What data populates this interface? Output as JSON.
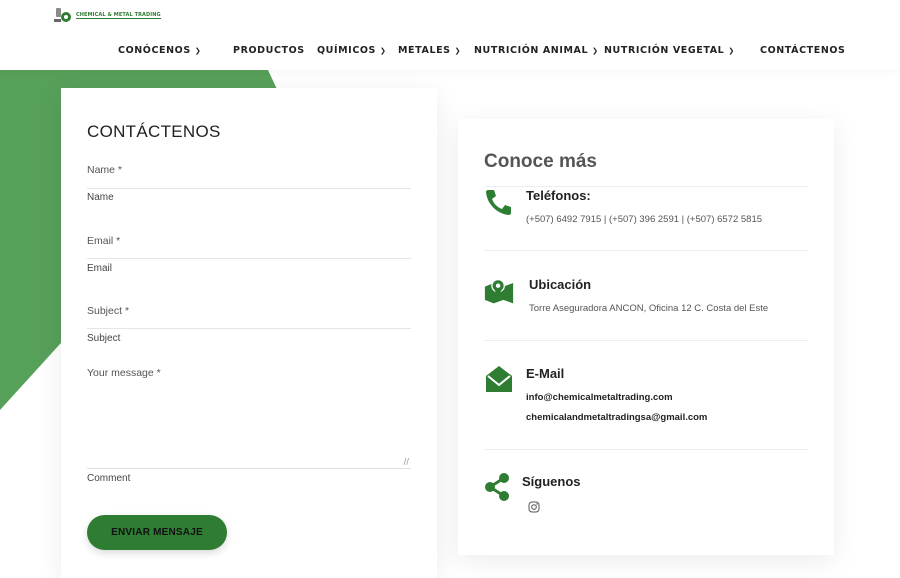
{
  "brand": {
    "logo_text": "CHEMICAL & METAL TRADING"
  },
  "nav": [
    {
      "label": "CONÓCENOS",
      "dropdown": true
    },
    {
      "label": "PRODUCTOS",
      "dropdown": false
    },
    {
      "label": "QUÍMICOS",
      "dropdown": true
    },
    {
      "label": "METALES",
      "dropdown": true
    },
    {
      "label": "NUTRICIÓN ANIMAL",
      "dropdown": true
    },
    {
      "label": "NUTRICIÓN VEGETAL",
      "dropdown": true
    },
    {
      "label": "CONTÁCTENOS",
      "dropdown": false
    }
  ],
  "form": {
    "title": "CONTÁCTENOS",
    "name_label": "Name *",
    "name_placeholder": "Name",
    "email_label": "Email *",
    "email_placeholder": "Email",
    "subject_label": "Subject *",
    "subject_placeholder": "Subject",
    "message_label": "Your message *",
    "message_placeholder": "Comment",
    "submit_label": "ENVIAR MENSAJE"
  },
  "info": {
    "title": "Conoce más",
    "phones_heading": "Teléfonos:",
    "phones_text": "(+507) 6492 7915 | (+507) 396 2591 | (+507) 6572 5815",
    "location_heading": "Ubicación",
    "location_text": "Torre Aseguradora ANCON, Oficina 12 C. Costa del Este",
    "email_heading": "E-Mail",
    "email_1": "info@chemicalmetaltrading.com",
    "email_2": "chemicalandmetaltradingsa@gmail.com",
    "follow_heading": "Síguenos"
  },
  "colors": {
    "brand_green": "#2e7d32",
    "bg_green": "#4caf50"
  },
  "icons": [
    "phone-icon",
    "map-icon",
    "mail-icon",
    "share-icon",
    "instagram-icon",
    "chevron-down-icon"
  ]
}
